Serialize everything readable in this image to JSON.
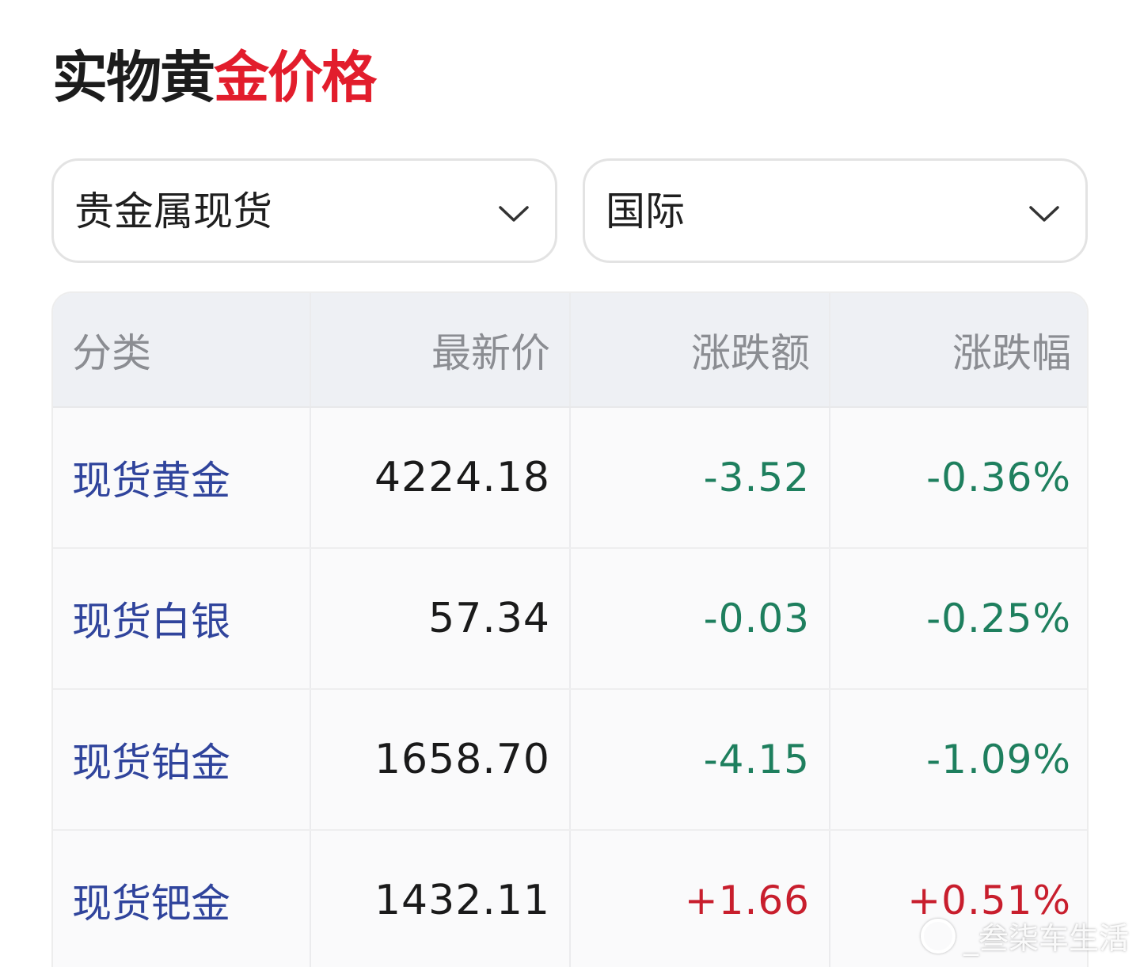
{
  "title": {
    "part1": "实物黄",
    "part2": "金价格"
  },
  "filters": {
    "category": {
      "value": "贵金属现货"
    },
    "market": {
      "value": "国际"
    }
  },
  "table": {
    "headers": [
      "分类",
      "最新价",
      "涨跌额",
      "涨跌幅"
    ],
    "rows": [
      {
        "name": "现货黄金",
        "price": "4224.18",
        "change": "-3.52",
        "change_pct": "-0.36%",
        "direction": "down"
      },
      {
        "name": "现货白银",
        "price": "57.34",
        "change": "-0.03",
        "change_pct": "-0.25%",
        "direction": "down"
      },
      {
        "name": "现货铂金",
        "price": "1658.70",
        "change": "-4.15",
        "change_pct": "-1.09%",
        "direction": "down"
      },
      {
        "name": "现货钯金",
        "price": "1432.11",
        "change": "+1.66",
        "change_pct": "+0.51%",
        "direction": "up"
      }
    ]
  },
  "colors": {
    "title_accent": "#e21d2c",
    "name_link": "#30449c",
    "down": "#1e7f5e",
    "up": "#c81e2d"
  },
  "watermark": {
    "text": "_叁柒车生活"
  }
}
